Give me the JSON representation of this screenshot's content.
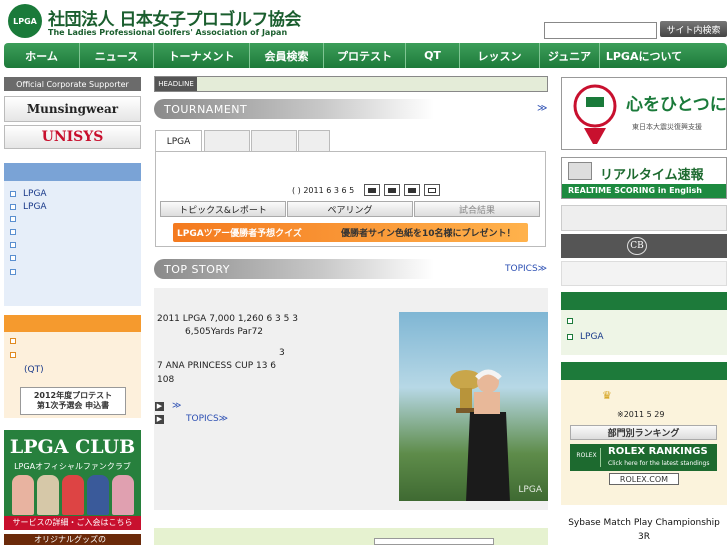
{
  "header": {
    "logo_badge": "LPGA",
    "title_jp": "社団法人 日本女子プロゴルフ協会",
    "title_en": "The Ladies Professional Golfers' Association of Japan",
    "search_placeholder": "",
    "search_button": "サイト内検索"
  },
  "nav": {
    "items": [
      "ホーム",
      "ニュース",
      "トーナメント",
      "会員検索",
      "プロテスト",
      "QT",
      "レッスン",
      "ジュニア",
      "LPGAについて"
    ]
  },
  "left": {
    "supporter_title": "Official Corporate Supporter",
    "sponsors": [
      "Munsingwear",
      "UNISYS"
    ],
    "box1_items": [
      "LPGA",
      "LPGA",
      "",
      "",
      "",
      "",
      ""
    ],
    "box2_items": [
      "",
      "",
      "(QT)"
    ],
    "protest_line1": "2012年度プロテスト",
    "protest_line2": "第1次予選会 申込書",
    "club_title": "LPGA CLUB",
    "club_subtitle": "LPGAオフィシャルファンクラブ",
    "club_footer": "サービスの詳細・ご入会はこちら",
    "bottom_text": "オリジナルグッズの"
  },
  "center": {
    "headline_label": "HEADLINE",
    "tournament_title": "TOURNAMENT",
    "tournament_more": "≫",
    "tabs": [
      "LPGA",
      "",
      "",
      ""
    ],
    "date_line": "( ) 2011 6 3  6 5",
    "buttons": [
      "トピックス&レポート",
      "ペアリング",
      "試合結果"
    ],
    "quiz_left": "LPGAツアー優勝者予想クイズ",
    "quiz_right": "優勝者サイン色紙を10名様にプレゼント！",
    "topstory_title": "TOP STORY",
    "topics_link": "TOPICS≫",
    "story_lines": [
      "2011  LPGA                7,000      1,260    6 3      5     3",
      "6,505Yards Par72",
      "3",
      "7             ANA PRINCESS CUP  13                      6",
      "108"
    ],
    "story_links": [
      "≫",
      "TOPICS≫"
    ],
    "photo_watermark": "LPGA"
  },
  "right": {
    "banner_text": "心をひとつに",
    "banner_sub": "東日本大震災復興支援",
    "realtime_title": "リアルタイム速報",
    "realtime_sub": "REALTIME SCORING in English",
    "box2_logo": "CB",
    "list1": [
      "",
      "LPGA"
    ],
    "crown": "♛",
    "rank_date": "※2011 5 29",
    "rank_button": "部門別ランキング",
    "rolex_title": "ROLEX RANKINGS",
    "rolex_sub": "Click here for the latest standings",
    "rolex_logo": "ROLEX",
    "rolex_com": "ROLEX.COM",
    "bottom_line1": "Sybase Match Play Championship",
    "bottom_line2": "3R"
  }
}
